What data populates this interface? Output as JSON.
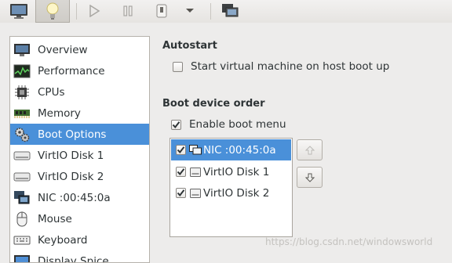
{
  "toolbar": {
    "buttons": [
      {
        "name": "console",
        "icon": "monitor-icon"
      },
      {
        "name": "details",
        "icon": "lightbulb-icon",
        "pressed": true
      },
      {
        "name": "run",
        "icon": "play-icon"
      },
      {
        "name": "pause",
        "icon": "pause-icon"
      },
      {
        "name": "shutdown",
        "icon": "power-icon"
      },
      {
        "name": "shutdown-menu",
        "icon": "chevron-down-icon"
      },
      {
        "name": "fullscreen",
        "icon": "screens-icon"
      }
    ]
  },
  "sidebar": {
    "selected_index": 4,
    "items": [
      {
        "label": "Overview",
        "icon": "monitor-icon"
      },
      {
        "label": "Performance",
        "icon": "performance-graph-icon"
      },
      {
        "label": "CPUs",
        "icon": "cpu-chip-icon"
      },
      {
        "label": "Memory",
        "icon": "memory-module-icon"
      },
      {
        "label": "Boot Options",
        "icon": "gears-icon"
      },
      {
        "label": "VirtIO Disk 1",
        "icon": "hard-disk-icon"
      },
      {
        "label": "VirtIO Disk 2",
        "icon": "hard-disk-icon"
      },
      {
        "label": "NIC :00:45:0a",
        "icon": "network-icon"
      },
      {
        "label": "Mouse",
        "icon": "mouse-icon"
      },
      {
        "label": "Keyboard",
        "icon": "keyboard-icon"
      },
      {
        "label": "Display Spice",
        "icon": "display-icon"
      }
    ]
  },
  "autostart": {
    "heading": "Autostart",
    "option_label": "Start virtual machine on host boot up",
    "checked": false
  },
  "boot_order": {
    "heading": "Boot device order",
    "enable_menu_label": "Enable boot menu",
    "enable_menu_checked": true,
    "devices": [
      {
        "label": "NIC :00:45:0a",
        "icon": "network-icon",
        "checked": true,
        "selected": true
      },
      {
        "label": "VirtIO Disk 1",
        "icon": "hard-disk-icon",
        "checked": true,
        "selected": false
      },
      {
        "label": "VirtIO Disk 2",
        "icon": "hard-disk-icon",
        "checked": true,
        "selected": false
      }
    ],
    "move_up_icon": "arrow-up-icon",
    "move_down_icon": "arrow-down-icon"
  },
  "watermark": "https://blog.csdn.net/windowsworld",
  "colors": {
    "selection": "#4a90d9",
    "window_bg": "#edeceb"
  }
}
